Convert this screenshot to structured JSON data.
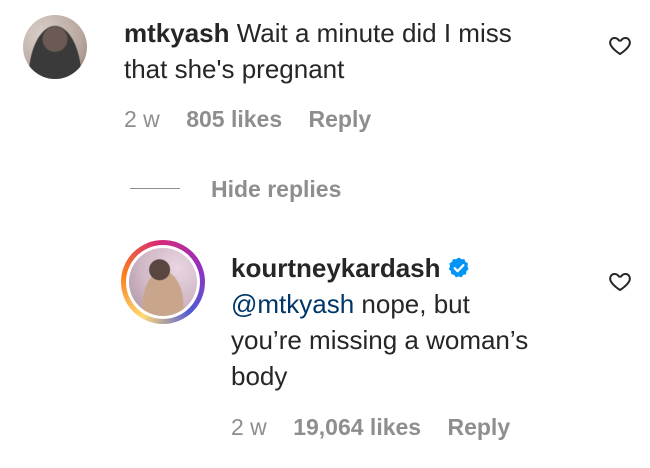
{
  "comments": [
    {
      "username": "mtkyash",
      "text_line1": "Wait a minute did I miss",
      "text_line2": "that she's pregnant",
      "time": "2 w",
      "likes": "805 likes",
      "reply": "Reply",
      "icons": {
        "avatar": "user-avatar",
        "like": "heart-outline-icon"
      }
    },
    {
      "username": "kourtneykardash",
      "verified": true,
      "mention": "@mtkyash",
      "text_line1_rest": " nope, but",
      "text_line2": "you’re missing a woman’s",
      "text_line3": "body",
      "time": "2 w",
      "likes": "19,064 likes",
      "reply": "Reply",
      "icons": {
        "avatar": "story-ring-avatar",
        "like": "heart-outline-icon",
        "badge": "verified-badge-icon"
      }
    }
  ],
  "thread": {
    "hide_replies": "Hide replies"
  },
  "colors": {
    "text": "#262626",
    "muted": "#8e8e8e",
    "mention": "#00376b",
    "verified": "#0095f6"
  }
}
